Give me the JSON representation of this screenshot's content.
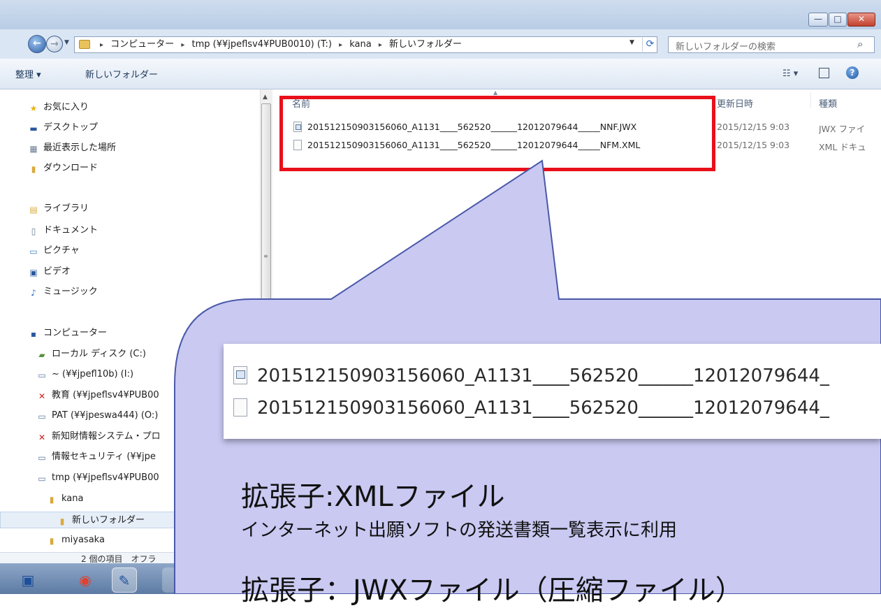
{
  "window": {
    "minimize_glyph": "—",
    "maximize_glyph": "□",
    "close_glyph": "✕"
  },
  "address": {
    "crumbs": [
      "コンピューター",
      "tmp (¥¥jpeflsv4¥PUB0010) (T:)",
      "kana",
      "新しいフォルダー"
    ],
    "separator": "▸",
    "search_placeholder": "新しいフォルダーの検索"
  },
  "toolbar": {
    "organize_label": "整理 ▾",
    "new_folder_label": "新しいフォルダー",
    "view_glyph": "☷ ▾",
    "help_glyph": "?"
  },
  "nav": {
    "items": [
      {
        "label": "お気に入り",
        "icon": "★"
      },
      {
        "label": "デスクトップ",
        "icon": "▬"
      },
      {
        "label": "最近表示した場所",
        "icon": "▦"
      },
      {
        "label": "ダウンロード",
        "icon": "▮"
      },
      {
        "label": "ライブラリ",
        "icon": "▤"
      },
      {
        "label": "ドキュメント",
        "icon": "▯"
      },
      {
        "label": "ピクチャ",
        "icon": "▭"
      },
      {
        "label": "ビデオ",
        "icon": "▣"
      },
      {
        "label": "ミュージック",
        "icon": "♪"
      },
      {
        "label": "コンピューター",
        "icon": "▪"
      },
      {
        "label": "ローカル ディスク (C:)",
        "icon": "▰"
      },
      {
        "label": "~ (¥¥jpefl10b) (I:)",
        "icon": "▭"
      },
      {
        "label": "教育 (¥¥jpeflsv4¥PUB00",
        "icon": "✕"
      },
      {
        "label": "PAT (¥¥jpeswa444) (O:)",
        "icon": "▭"
      },
      {
        "label": "新知財情報システム・プロ",
        "icon": "✕"
      },
      {
        "label": "情報セキュリティ (¥¥jpe",
        "icon": "▭"
      },
      {
        "label": "tmp (¥¥jpeflsv4¥PUB00",
        "icon": "▭"
      },
      {
        "label": "kana",
        "icon": "▮"
      },
      {
        "label": "新しいフォルダー",
        "icon": "▮"
      },
      {
        "label": "miyasaka",
        "icon": "▮"
      }
    ]
  },
  "columns": {
    "name": "名前",
    "modified": "更新日時",
    "type": "種類"
  },
  "files": [
    {
      "name": "201512150903156060_A1131____562520______12012079644_____NNF.JWX",
      "modified": "2015/12/15 9:03",
      "type": "JWX ファイ",
      "kind": "jwx"
    },
    {
      "name": "201512150903156060_A1131____562520______12012079644_____NFM.XML",
      "modified": "2015/12/15 9:03",
      "type": "XML ドキュ",
      "kind": "xml"
    }
  ],
  "status": {
    "text": "2 個の項目　オフラ"
  },
  "callout": {
    "zoom_rows": [
      {
        "text": "201512150903156060_A1131____562520______12012079644_",
        "kind": "jwx"
      },
      {
        "text": "201512150903156060_A1131____562520______12012079644_",
        "kind": "xml"
      }
    ],
    "heading1": "拡張子:XMLファイル",
    "text1": "インターネット出願ソフトの発送書類一覧表示に利用",
    "heading2": "拡張子：JWXファイル（圧縮ファイル）"
  },
  "colors": {
    "highlight": "#e8101a",
    "callout_fill": "#c9c9f2",
    "callout_stroke": "#4a58a8"
  }
}
